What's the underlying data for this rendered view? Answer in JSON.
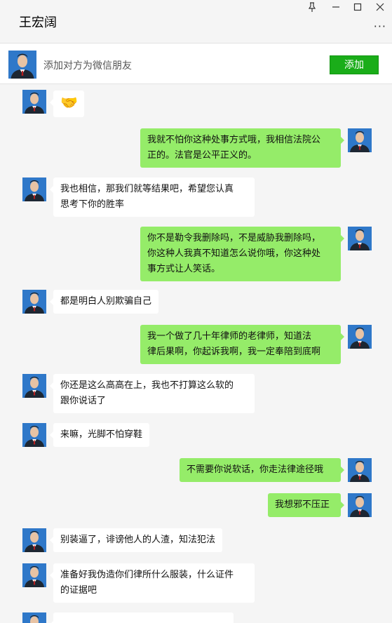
{
  "window": {
    "title": "王宏阔",
    "pin_icon": "pin-icon",
    "minimize_icon": "minimize-icon",
    "maximize_icon": "maximize-icon",
    "close_icon": "close-icon",
    "more_icon": "more-icon"
  },
  "add_friend": {
    "prompt": "添加对方为微信朋友",
    "button_label": "添加",
    "button_color": "#1aad19"
  },
  "colors": {
    "my_bubble": "#95ec69",
    "their_bubble": "#ffffff",
    "avatar_bg": "#2f78c9"
  },
  "messages": [
    {
      "side": "left",
      "text": "🤝",
      "icon": "handshake-emoji"
    },
    {
      "side": "right",
      "text": "我就不怕你这种处事方式哦，我相信法院公\n正的。法官是公平正义的。"
    },
    {
      "side": "left",
      "text": "我也相信，那我们就等结果吧，希望您认真\n思考下你的胜率"
    },
    {
      "side": "right",
      "text": "你不是勒令我删除吗，不是威胁我删除吗，\n你这种人我真不知道怎么说你哦，你这种处\n事方式让人笑话。"
    },
    {
      "side": "left",
      "text": "都是明白人别欺骗自己"
    },
    {
      "side": "right",
      "text": "我一个做了几十年律师的老律师，知道法\n律后果啊，你起诉我啊，我一定奉陪到底啊"
    },
    {
      "side": "left",
      "text": "你还是这么高高在上，我也不打算这么软的\n跟你说话了"
    },
    {
      "side": "left",
      "text": "来嘛，光脚不怕穿鞋"
    },
    {
      "side": "right",
      "text": "不需要你说软话，你走法律途径哦"
    },
    {
      "side": "right",
      "text": "我想邪不压正"
    },
    {
      "side": "left",
      "text": "别装逼了，诽谤他人的人渣，知法犯法"
    },
    {
      "side": "left",
      "text": "准备好我伪造你们律所什么服装，什么证件\n的证据吧"
    }
  ]
}
